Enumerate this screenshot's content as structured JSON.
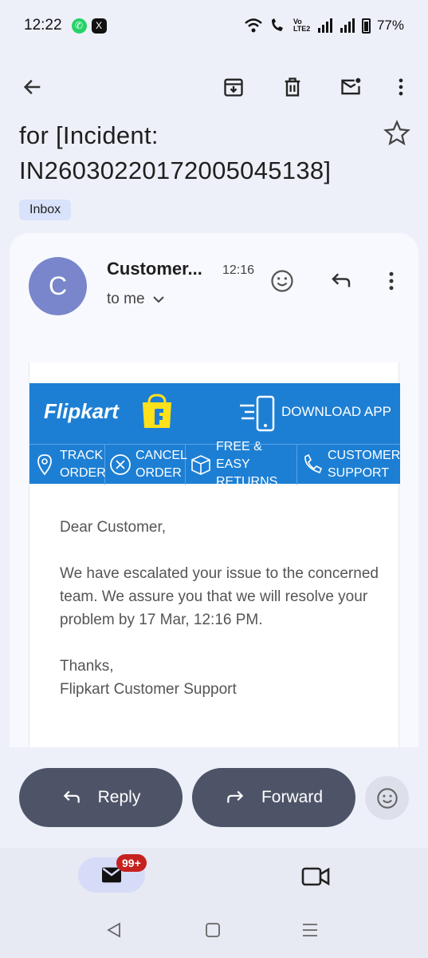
{
  "status": {
    "time": "12:22",
    "network": "Vo LTE2",
    "battery": "77%"
  },
  "email": {
    "subject": "for [Incident: IN2603022017200504513​8]",
    "label": "Inbox",
    "sender_initial": "C",
    "sender": "Customer...",
    "time": "12:16",
    "recipient": "to me"
  },
  "flipkart": {
    "logo": "Flipkart",
    "download": "DOWNLOAD APP",
    "nav": [
      {
        "line1": "TRACK",
        "line2": "ORDER",
        "icon": "location-pin-icon"
      },
      {
        "line1": "CANCEL",
        "line2": "ORDER",
        "icon": "cancel-circle-icon"
      },
      {
        "line1": "FREE & EASY",
        "line2": "RETURNS",
        "icon": "return-box-icon"
      },
      {
        "line1": "CUSTOMER",
        "line2": "SUPPORT",
        "icon": "phone-icon"
      }
    ]
  },
  "body": {
    "greeting": "Dear Customer,",
    "message": "We have escalated your issue to the concerned team. We assure you that we will resolve your problem by 17 Mar, 12:16 PM.",
    "thanks": "Thanks,",
    "signature": "Flipkart Customer Support"
  },
  "actions": {
    "reply": "Reply",
    "forward": "Forward"
  },
  "nav": {
    "mail_badge": "99+"
  },
  "colors": {
    "flipkart_blue": "#1d7fd4",
    "button_dark": "#4e5468",
    "avatar": "#7986cb",
    "badge": "#c5221f"
  }
}
